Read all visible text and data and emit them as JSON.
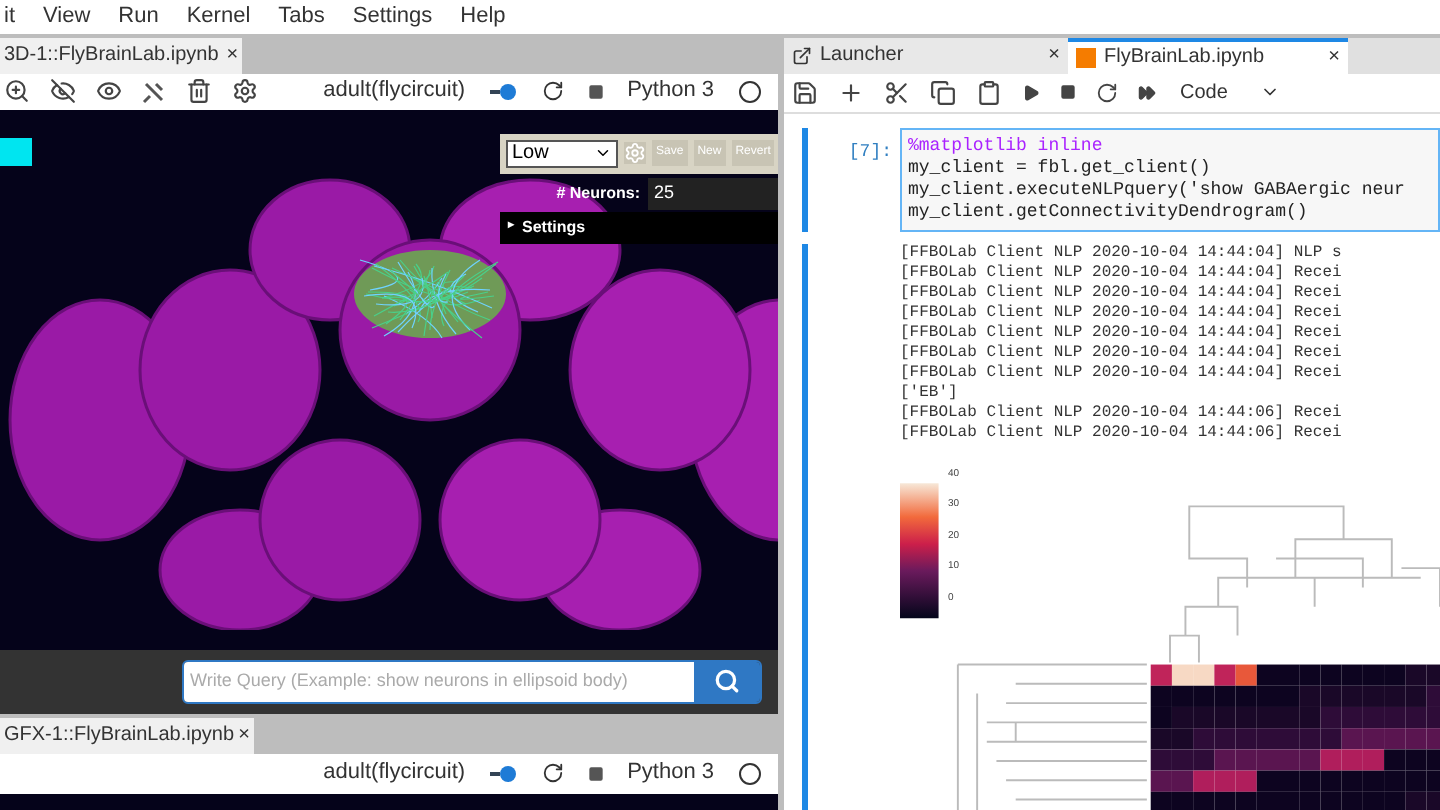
{
  "menu": [
    "it",
    "View",
    "Run",
    "Kernel",
    "Tabs",
    "Settings",
    "Help"
  ],
  "left_top": {
    "tab": {
      "label": "3D-1::FlyBrainLab.ipynb",
      "close": "×"
    },
    "kernel_source": "adult(flycircuit)",
    "kernel": "Python 3",
    "controls": {
      "quality": "Low",
      "buttons": [
        "Save",
        "New",
        "Revert"
      ],
      "neurons_label": "# Neurons:",
      "neurons_value": "25",
      "settings": "Settings",
      "settings_icon": "▸"
    },
    "query": {
      "placeholder": "Write Query (Example: show neurons in ellipsoid body)"
    }
  },
  "left_bottom": {
    "tab": {
      "label": "GFX-1::FlyBrainLab.ipynb",
      "close": "×"
    },
    "kernel_source": "adult(flycircuit)",
    "kernel": "Python 3"
  },
  "right": {
    "tabs": [
      {
        "label": "Launcher",
        "selected": false,
        "close": "×"
      },
      {
        "label": "FlyBrainLab.ipynb",
        "selected": true,
        "close": "×"
      }
    ],
    "cell_type": "Code",
    "prompt": "[7]:",
    "code": [
      "%matplotlib inline",
      "my_client = fbl.get_client()",
      "my_client.executeNLPquery('show GABAergic neur",
      "my_client.getConnectivityDendrogram()"
    ],
    "output": [
      "[FFBOLab Client NLP 2020-10-04 14:44:04] NLP s",
      "[FFBOLab Client NLP 2020-10-04 14:44:04] Recei",
      "[FFBOLab Client NLP 2020-10-04 14:44:04] Recei",
      "[FFBOLab Client NLP 2020-10-04 14:44:04] Recei",
      "[FFBOLab Client NLP 2020-10-04 14:44:04] Recei",
      "[FFBOLab Client NLP 2020-10-04 14:44:04] Recei",
      "[FFBOLab Client NLP 2020-10-04 14:44:04] Recei",
      "['EB']",
      "[FFBOLab Client NLP 2020-10-04 14:44:06] Recei",
      "[FFBOLab Client NLP 2020-10-04 14:44:06] Recei"
    ],
    "colorbar_ticks": [
      "40",
      "30",
      "20",
      "10",
      "0"
    ]
  }
}
